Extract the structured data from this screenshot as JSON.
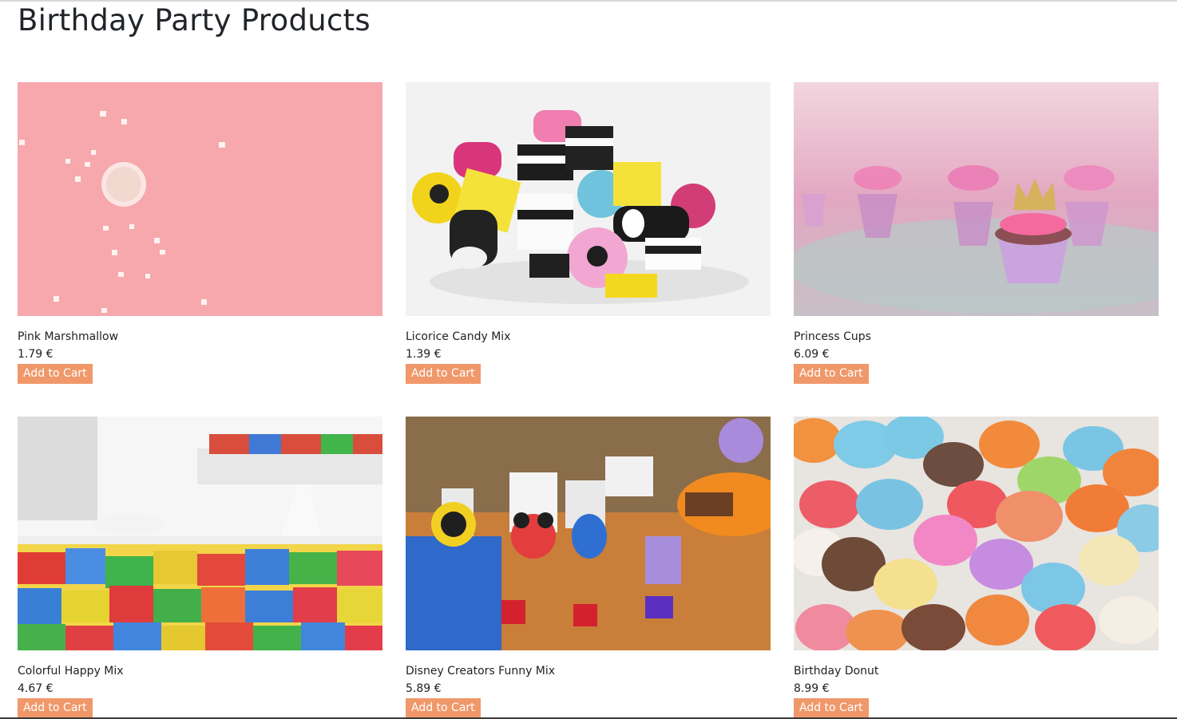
{
  "page": {
    "title": "Birthday Party Products"
  },
  "products": [
    {
      "name": "Pink Marshmallow",
      "price": "1.79 €",
      "button": "Add to Cart"
    },
    {
      "name": "Licorice Candy Mix",
      "price": "1.39 €",
      "button": "Add to Cart"
    },
    {
      "name": "Princess Cups",
      "price": "6.09 €",
      "button": "Add to Cart"
    },
    {
      "name": "Colorful Happy Mix",
      "price": "4.67 €",
      "button": "Add to Cart"
    },
    {
      "name": "Disney Creators Funny Mix",
      "price": "5.89 €",
      "button": "Add to Cart"
    },
    {
      "name": "Birthday Donut",
      "price": "8.99 €",
      "button": "Add to Cart"
    }
  ],
  "colors": {
    "button": "#f0986a",
    "text": "#212529"
  }
}
